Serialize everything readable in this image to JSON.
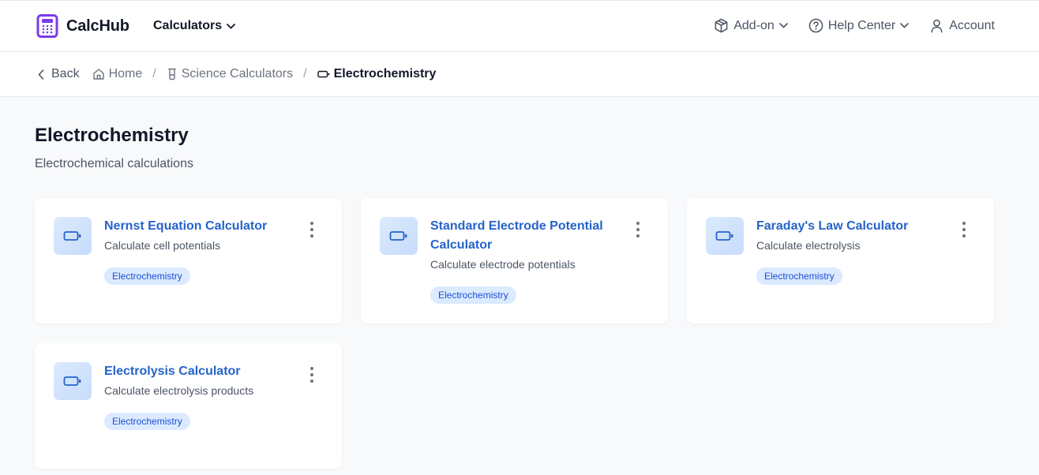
{
  "header": {
    "brand": "CalcHub",
    "calculators_menu": "Calculators",
    "addon_menu": "Add-on",
    "help_menu": "Help Center",
    "account": "Account"
  },
  "breadcrumb": {
    "back": "Back",
    "items": [
      "Home",
      "Science Calculators",
      "Electrochemistry"
    ]
  },
  "page": {
    "title": "Electrochemistry",
    "subtitle": "Electrochemical calculations"
  },
  "cards": [
    {
      "title": "Nernst Equation Calculator",
      "description": "Calculate cell potentials",
      "tag": "Electrochemistry",
      "icon": "battery-icon"
    },
    {
      "title": "Standard Electrode Potential Calculator",
      "description": "Calculate electrode potentials",
      "tag": "Electrochemistry",
      "icon": "battery-icon"
    },
    {
      "title": "Faraday's Law Calculator",
      "description": "Calculate electrolysis",
      "tag": "Electrochemistry",
      "icon": "battery-icon"
    },
    {
      "title": "Electrolysis Calculator",
      "description": "Calculate electrolysis products",
      "tag": "Electrochemistry",
      "icon": "battery-icon"
    }
  ],
  "colors": {
    "brand": "#7c3aed",
    "link": "#2563c9",
    "tag_bg": "#dbeafe",
    "tag_text": "#1d4ed8"
  }
}
